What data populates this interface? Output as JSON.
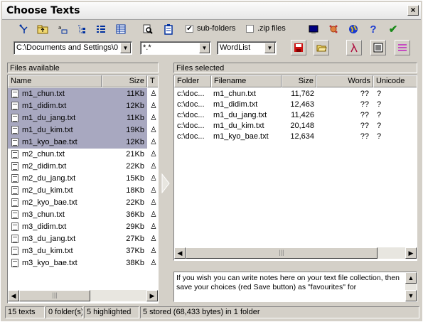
{
  "window": {
    "title": "Choose Texts",
    "close_glyph": "×"
  },
  "toolbar": {
    "subfolders_label": "sub-folders",
    "subfolders_checked": true,
    "zip_label": ".zip files",
    "zip_checked": false,
    "help_glyph": "?",
    "ok_glyph": "✔"
  },
  "path_combo": {
    "value": "C:\\Documents and Settings\\0"
  },
  "filter_combo": {
    "value": "*.*"
  },
  "mode_combo": {
    "value": "WordList"
  },
  "files_available": {
    "header": "Files available",
    "columns": {
      "name": "Name",
      "size": "Size",
      "t": "T"
    },
    "rows": [
      {
        "name": "m1_chun.txt",
        "size": "11Kb",
        "selected": true
      },
      {
        "name": "m1_didim.txt",
        "size": "12Kb",
        "selected": true
      },
      {
        "name": "m1_du_jang.txt",
        "size": "11Kb",
        "selected": true
      },
      {
        "name": "m1_du_kim.txt",
        "size": "19Kb",
        "selected": true
      },
      {
        "name": "m1_kyo_bae.txt",
        "size": "12Kb",
        "selected": true
      },
      {
        "name": "m2_chun.txt",
        "size": "21Kb",
        "selected": false
      },
      {
        "name": "m2_didim.txt",
        "size": "22Kb",
        "selected": false
      },
      {
        "name": "m2_du_jang.txt",
        "size": "15Kb",
        "selected": false
      },
      {
        "name": "m2_du_kim.txt",
        "size": "18Kb",
        "selected": false
      },
      {
        "name": "m2_kyo_bae.txt",
        "size": "22Kb",
        "selected": false
      },
      {
        "name": "m3_chun.txt",
        "size": "36Kb",
        "selected": false
      },
      {
        "name": "m3_didim.txt",
        "size": "29Kb",
        "selected": false
      },
      {
        "name": "m3_du_jang.txt",
        "size": "27Kb",
        "selected": false
      },
      {
        "name": "m3_du_kim.txt",
        "size": "37Kb",
        "selected": false
      },
      {
        "name": "m3_kyo_bae.txt",
        "size": "38Kb",
        "selected": false
      }
    ]
  },
  "files_selected": {
    "header": "Files selected",
    "columns": {
      "folder": "Folder",
      "filename": "Filename",
      "size": "Size",
      "words": "Words",
      "unicode": "Unicode"
    },
    "rows": [
      {
        "folder": "c:\\doc...",
        "filename": "m1_chun.txt",
        "size": "11,762",
        "words": "??",
        "unicode": "?"
      },
      {
        "folder": "c:\\doc...",
        "filename": "m1_didim.txt",
        "size": "12,463",
        "words": "??",
        "unicode": "?"
      },
      {
        "folder": "c:\\doc...",
        "filename": "m1_du_jang.txt",
        "size": "11,426",
        "words": "??",
        "unicode": "?"
      },
      {
        "folder": "c:\\doc...",
        "filename": "m1_du_kim.txt",
        "size": "20,148",
        "words": "??",
        "unicode": "?"
      },
      {
        "folder": "c:\\doc...",
        "filename": "m1_kyo_bae.txt",
        "size": "12,634",
        "words": "??",
        "unicode": "?"
      }
    ]
  },
  "notes": {
    "text": "If you wish you can write notes here on your text file collection, then save your choices (red Save button) as \"favourites\" for"
  },
  "statusbar": {
    "texts": "15 texts",
    "folders": "0 folder(s)",
    "highlighted": "5 highlighted",
    "stored": "5 stored (68,433 bytes) in 1 folder"
  },
  "colors": {
    "selection": "#a8a8c0",
    "face": "#d4d0c8",
    "save_red": "#cc1010",
    "ok_green": "#1a8a1a",
    "help_blue": "#1a3ad0"
  }
}
